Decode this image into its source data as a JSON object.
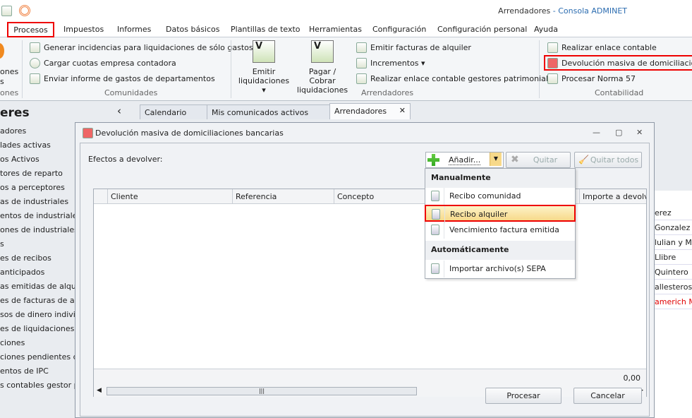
{
  "window": {
    "title_prefix": "Arrendadores",
    "title_sep": " - ",
    "title_app": "Consola ADMINET"
  },
  "menu_tabs": [
    "Procesos",
    "Impuestos",
    "Informes",
    "Datos básicos",
    "Plantillas de texto",
    "Herramientas",
    "Configuración",
    "Configuración personal",
    "Ayuda"
  ],
  "ribbon": {
    "partial_group": {
      "label_1": "ones",
      "label_2": "s",
      "group": "ones"
    },
    "comunidades": {
      "items": [
        "Generar incidencias para liquidaciones de sólo gastos",
        "Cargar cuotas empresa contadora",
        "Enviar informe de gastos de departamentos"
      ],
      "group": "Comunidades"
    },
    "arrendadores": {
      "emitir": [
        "Emitir",
        "liquidaciones ▾"
      ],
      "pagar": [
        "Pagar / Cobrar",
        "liquidaciones"
      ],
      "items": [
        "Emitir facturas de alquiler",
        "Incrementos ▾",
        "Realizar enlace contable gestores patrimoniales"
      ],
      "group": "Arrendadores"
    },
    "contabilidad": {
      "items": [
        "Realizar enlace contable",
        "Devolución masiva de domiciliaciones",
        "Procesar Norma 57"
      ],
      "group": "Contabilidad"
    }
  },
  "doc_tabs": {
    "collapse": "‹",
    "tabs": [
      "Calendario",
      "Mis comunicados activos",
      "Arrendadores"
    ],
    "close": "✕"
  },
  "left_panel": {
    "title": "eres",
    "items": [
      "adores",
      "lades activas",
      "os Activos",
      "tores de reparto",
      "os a perceptores",
      "as de industriales",
      "entos de industriales",
      "ones de industriales",
      "s",
      "es de recibos",
      " anticipados",
      "as emitidas de alquiler",
      "es de facturas de alqu",
      "sos de dinero individua",
      "es de liquidaciones",
      "ciones",
      "ciones pendientes de p",
      "entos de IPC",
      "s contables gestor patr"
    ]
  },
  "right_panel": {
    "items": [
      "erez",
      " Gonzalez",
      "lulian y Mar",
      "Llibre",
      "Quintero",
      "allesteros",
      "americh Mir"
    ],
    "highlight_color": "#e00000"
  },
  "dialog": {
    "title": "Devolución masiva de domiciliaciones bancarias",
    "controls": {
      "minimize": "—",
      "restore": "▢",
      "close": "✕"
    },
    "label": "Efectos a devolver:",
    "add_button": "Añadir...",
    "remove_button": "Quitar",
    "remove_all_button": "Quitar todos",
    "columns": [
      "Cliente",
      "Referencia",
      "Concepto",
      "Importe a devolver"
    ],
    "total": "0,00",
    "scroll_grip": "|||",
    "process_button": "Procesar",
    "cancel_button": "Cancelar"
  },
  "dropdown": {
    "sections": [
      {
        "header": "Manualmente",
        "items": [
          "Recibo comunidad",
          "Recibo alquiler",
          "Vencimiento factura emitida"
        ]
      },
      {
        "header": "Automáticamente",
        "items": [
          "Importar archivo(s) SEPA"
        ]
      }
    ],
    "selected": "Recibo alquiler"
  },
  "colors": {
    "accent_highlight": "#e00000",
    "menu_hover": "#f7d98a"
  }
}
